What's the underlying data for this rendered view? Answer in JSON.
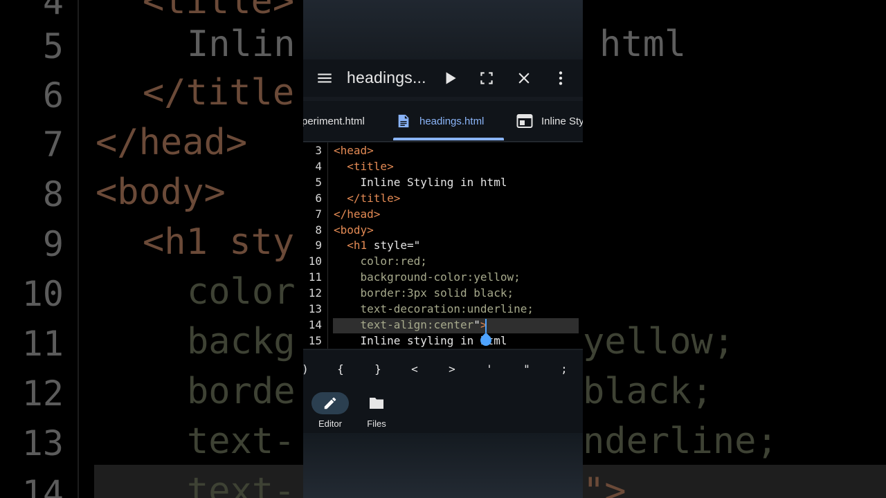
{
  "background": {
    "line_numbers": [
      "4",
      "5",
      "6",
      "7",
      "8",
      "9",
      "10",
      "11",
      "12",
      "13",
      "14"
    ],
    "code": [
      {
        "text": "<title>",
        "kind": "tag"
      },
      {
        "text": "Inlin",
        "kind": "txt"
      },
      {
        "text": "html",
        "kind": "txt"
      },
      {
        "text": "</title",
        "kind": "tag"
      },
      {
        "text": "</head>",
        "kind": "tag"
      },
      {
        "text": "<body>",
        "kind": "tag"
      },
      {
        "text": "<h1 sty",
        "kind": "tag"
      },
      {
        "text": "color",
        "kind": "css"
      },
      {
        "text": "backg",
        "kind": "css"
      },
      {
        "text": "yellow;",
        "kind": "css"
      },
      {
        "text": "borde",
        "kind": "css"
      },
      {
        "text": "black;",
        "kind": "css"
      },
      {
        "text": "text-",
        "kind": "css"
      },
      {
        "text": "nderline;",
        "kind": "css"
      },
      {
        "text": "text-",
        "kind": "css"
      },
      {
        "text": "\">",
        "kind": "tag"
      }
    ]
  },
  "toolbar": {
    "menu_icon": "menu-icon",
    "title": "headings...",
    "run_icon": "play-icon",
    "fullscreen_icon": "fullscreen-icon",
    "close_icon": "close-icon",
    "more_icon": "more-vert-icon"
  },
  "tabs": [
    {
      "label": "periment.html",
      "icon": "",
      "active": false
    },
    {
      "label": "headings.html",
      "icon": "document-icon",
      "active": true
    },
    {
      "label": "Inline Sty",
      "icon": "browser-window-icon",
      "active": false
    }
  ],
  "editor": {
    "lines": [
      {
        "num": "3",
        "parts": [
          {
            "t": "<head>",
            "k": "t"
          }
        ]
      },
      {
        "num": "4",
        "parts": [
          {
            "t": "  ",
            "k": "a"
          },
          {
            "t": "<title>",
            "k": "t"
          }
        ]
      },
      {
        "num": "5",
        "parts": [
          {
            "t": "    Inline Styling in html",
            "k": "a"
          }
        ]
      },
      {
        "num": "6",
        "parts": [
          {
            "t": "  ",
            "k": "a"
          },
          {
            "t": "</title>",
            "k": "t"
          }
        ]
      },
      {
        "num": "7",
        "parts": [
          {
            "t": "</head>",
            "k": "t"
          }
        ]
      },
      {
        "num": "8",
        "parts": [
          {
            "t": "<body>",
            "k": "t"
          }
        ]
      },
      {
        "num": "9",
        "parts": [
          {
            "t": "  ",
            "k": "a"
          },
          {
            "t": "<h1",
            "k": "t"
          },
          {
            "t": " style=\"",
            "k": "a"
          }
        ]
      },
      {
        "num": "10",
        "parts": [
          {
            "t": "    color:red;",
            "k": "c"
          }
        ]
      },
      {
        "num": "11",
        "parts": [
          {
            "t": "    background-color:yellow;",
            "k": "c"
          }
        ]
      },
      {
        "num": "12",
        "parts": [
          {
            "t": "    border:3px solid black;",
            "k": "c"
          }
        ]
      },
      {
        "num": "13",
        "parts": [
          {
            "t": "    text-decoration:underline;",
            "k": "c"
          }
        ]
      },
      {
        "num": "14",
        "parts": [
          {
            "t": "    text-align:center",
            "k": "c"
          },
          {
            "t": "\"",
            "k": "a"
          },
          {
            "t": ">",
            "k": "t"
          }
        ]
      },
      {
        "num": "15",
        "parts": [
          {
            "t": "    Inline styling in html",
            "k": "a"
          }
        ]
      }
    ],
    "current_line": "14"
  },
  "symbol_keys": [
    ")",
    "{",
    "}",
    "<",
    ">",
    "'",
    "\"",
    ";"
  ],
  "bottom_nav": [
    {
      "label": "Editor",
      "icon": "pencil-icon",
      "active": true
    },
    {
      "label": "Files",
      "icon": "folder-icon",
      "active": false
    }
  ],
  "colors": {
    "accent": "#8ab4f8",
    "tag": "#e38a54",
    "css_value": "#a7aa8c",
    "caret": "#4ea3ff"
  }
}
